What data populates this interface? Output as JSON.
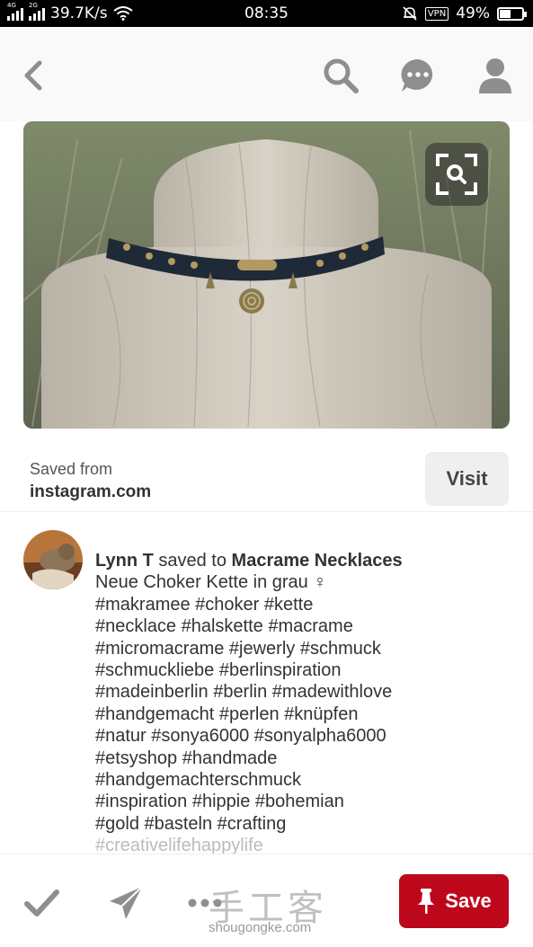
{
  "status_bar": {
    "speed": "39.7K/s",
    "time": "08:35",
    "vpn": "VPN",
    "battery": "49%",
    "battery_level": 0.49,
    "sim1_tag": "4G",
    "sim2_tag": "2G"
  },
  "nav": {
    "icons": [
      "back-icon",
      "search-icon",
      "chat-icon",
      "profile-icon"
    ]
  },
  "pin": {
    "saved_from_label": "Saved from",
    "source_domain": "instagram.com",
    "visit_label": "Visit"
  },
  "description": {
    "user": "Lynn T",
    "saved_to": " saved to ",
    "board": "Macrame Necklaces",
    "text": "Neue Choker Kette in grau ♀\n#makramee #choker #kette\n#necklace #halskette #macrame\n#micromacrame #jewerly #schmuck\n#schmuckliebe #berlinspiration\n#madeinberlin #berlin #madewithlove\n#handgemacht #perlen #knüpfen\n#natur #sonya6000 #sonyalpha6000\n#etsyshop #handmade\n#handgemachterschmuck\n#inspiration #hippie #bohemian\n#gold #basteln #crafting",
    "faded_line": "#creativelifehappylife"
  },
  "toolbar": {
    "save_label": "Save",
    "icons": [
      "check-icon",
      "send-icon",
      "more-icon",
      "pin-icon"
    ]
  },
  "watermark": {
    "main": "手工客",
    "sub": "shougongke.com"
  },
  "colors": {
    "save_red": "#bd081c",
    "icon_gray": "#8e8e8e"
  }
}
